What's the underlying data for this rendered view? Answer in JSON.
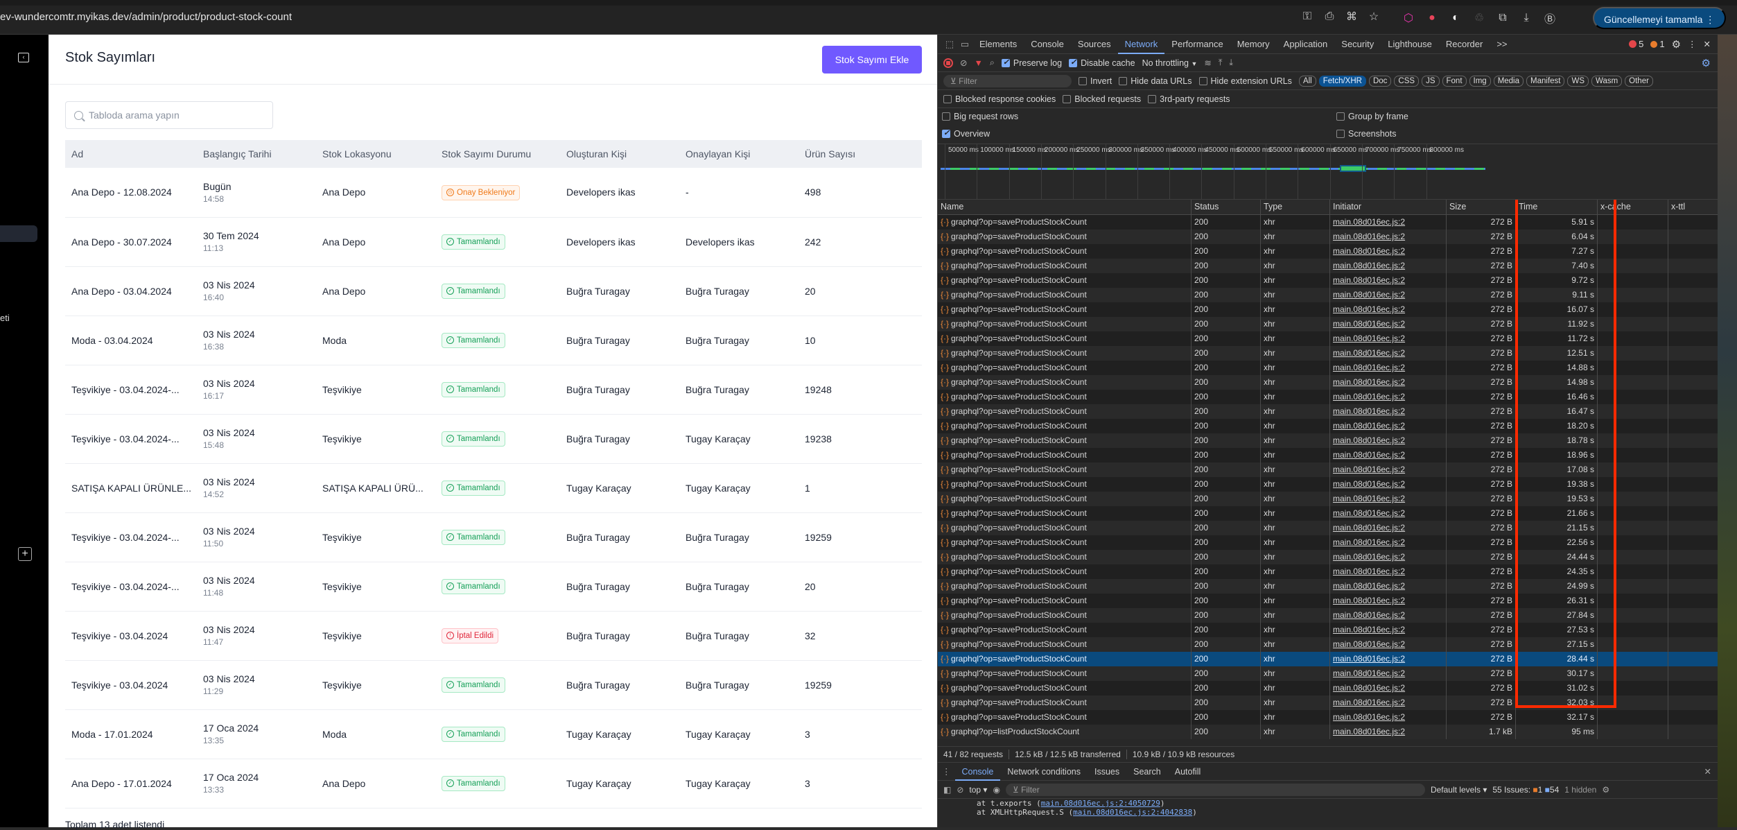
{
  "browser": {
    "url": "ev-wundercomtr.myikas.dev/admin/product/product-stock-count",
    "update_button": "Güncellemeyi tamamla",
    "omnibox_icons": [
      "key-icon",
      "install-icon",
      "translate-icon",
      "star-icon"
    ],
    "extension_icons": [
      "graphql-extension-icon",
      "strawberry-extension-icon",
      "color-extension-icon",
      "recycle-extension-icon",
      "puzzle-icon",
      "download-icon",
      "profile-avatar-icon"
    ]
  },
  "sidebar": {
    "partial_label": "eti"
  },
  "page": {
    "title": "Stok Sayımları",
    "add_button": "Stok Sayımı Ekle",
    "search_placeholder": "Tabloda arama yapın",
    "columns": [
      "Ad",
      "Başlangıç Tarihi",
      "Stok Lokasyonu",
      "Stok Sayımı Durumu",
      "Oluşturan Kişi",
      "Onaylayan Kişi",
      "Ürün Sayısı"
    ],
    "rows": [
      {
        "name": "Ana Depo - 12.08.2024",
        "date": "Bugün",
        "time": "14:58",
        "location": "Ana Depo",
        "status": "Onay Bekleniyor",
        "status_type": "pending",
        "creator": "Developers ikas",
        "approver": "-",
        "count": "498"
      },
      {
        "name": "Ana Depo - 30.07.2024",
        "date": "30 Tem 2024",
        "time": "11:13",
        "location": "Ana Depo",
        "status": "Tamamlandı",
        "status_type": "done",
        "creator": "Developers ikas",
        "approver": "Developers ikas",
        "count": "242"
      },
      {
        "name": "Ana Depo - 03.04.2024",
        "date": "03 Nis 2024",
        "time": "16:40",
        "location": "Ana Depo",
        "status": "Tamamlandı",
        "status_type": "done",
        "creator": "Buğra Turagay",
        "approver": "Buğra Turagay",
        "count": "20"
      },
      {
        "name": "Moda - 03.04.2024",
        "date": "03 Nis 2024",
        "time": "16:38",
        "location": "Moda",
        "status": "Tamamlandı",
        "status_type": "done",
        "creator": "Buğra Turagay",
        "approver": "Buğra Turagay",
        "count": "10"
      },
      {
        "name": "Teşvikiye - 03.04.2024-...",
        "date": "03 Nis 2024",
        "time": "16:17",
        "location": "Teşvikiye",
        "status": "Tamamlandı",
        "status_type": "done",
        "creator": "Buğra Turagay",
        "approver": "Buğra Turagay",
        "count": "19248"
      },
      {
        "name": "Teşvikiye - 03.04.2024-...",
        "date": "03 Nis 2024",
        "time": "15:48",
        "location": "Teşvikiye",
        "status": "Tamamlandı",
        "status_type": "done",
        "creator": "Buğra Turagay",
        "approver": "Tugay Karaçay",
        "count": "19238"
      },
      {
        "name": "SATIŞA KAPALI ÜRÜNLE...",
        "date": "03 Nis 2024",
        "time": "14:52",
        "location": "SATIŞA KAPALI ÜRÜ...",
        "status": "Tamamlandı",
        "status_type": "done",
        "creator": "Tugay Karaçay",
        "approver": "Tugay Karaçay",
        "count": "1"
      },
      {
        "name": "Teşvikiye - 03.04.2024-...",
        "date": "03 Nis 2024",
        "time": "11:50",
        "location": "Teşvikiye",
        "status": "Tamamlandı",
        "status_type": "done",
        "creator": "Buğra Turagay",
        "approver": "Buğra Turagay",
        "count": "19259"
      },
      {
        "name": "Teşvikiye - 03.04.2024-...",
        "date": "03 Nis 2024",
        "time": "11:48",
        "location": "Teşvikiye",
        "status": "Tamamlandı",
        "status_type": "done",
        "creator": "Buğra Turagay",
        "approver": "Buğra Turagay",
        "count": "20"
      },
      {
        "name": "Teşvikiye - 03.04.2024",
        "date": "03 Nis 2024",
        "time": "11:47",
        "location": "Teşvikiye",
        "status": "İptal Edildi",
        "status_type": "cancel",
        "creator": "Buğra Turagay",
        "approver": "Buğra Turagay",
        "count": "32"
      },
      {
        "name": "Teşvikiye - 03.04.2024",
        "date": "03 Nis 2024",
        "time": "11:29",
        "location": "Teşvikiye",
        "status": "Tamamlandı",
        "status_type": "done",
        "creator": "Buğra Turagay",
        "approver": "Buğra Turagay",
        "count": "19259"
      },
      {
        "name": "Moda - 17.01.2024",
        "date": "17 Oca 2024",
        "time": "13:35",
        "location": "Moda",
        "status": "Tamamlandı",
        "status_type": "done",
        "creator": "Tugay Karaçay",
        "approver": "Tugay Karaçay",
        "count": "3"
      },
      {
        "name": "Ana Depo - 17.01.2024",
        "date": "17 Oca 2024",
        "time": "13:33",
        "location": "Ana Depo",
        "status": "Tamamlandı",
        "status_type": "done",
        "creator": "Tugay Karaçay",
        "approver": "Tugay Karaçay",
        "count": "3"
      }
    ],
    "footer": "Toplam 13 adet listendi"
  },
  "devtools": {
    "tabs": [
      "Elements",
      "Console",
      "Sources",
      "Network",
      "Performance",
      "Memory",
      "Application",
      "Security",
      "Lighthouse",
      "Recorder"
    ],
    "active_tab": "Network",
    "more_tabs": ">>",
    "error_count": "5",
    "warning_count": "1",
    "toolbar": {
      "preserve_log": "Preserve log",
      "disable_cache": "Disable cache",
      "throttling": "No throttling"
    },
    "filter": {
      "placeholder": "Filter",
      "invert": "Invert",
      "hide_data_urls": "Hide data URLs",
      "hide_extension_urls": "Hide extension URLs",
      "types": [
        "All",
        "Fetch/XHR",
        "Doc",
        "CSS",
        "JS",
        "Font",
        "Img",
        "Media",
        "Manifest",
        "WS",
        "Wasm",
        "Other"
      ],
      "selected_type": "Fetch/XHR",
      "blocked_response_cookies": "Blocked response cookies",
      "blocked_requests": "Blocked requests",
      "third_party": "3rd-party requests"
    },
    "options": {
      "big_rows": "Big request rows",
      "group_by_frame": "Group by frame",
      "overview": "Overview",
      "screenshots": "Screenshots"
    },
    "overview_ticks": [
      "50000 ms",
      "100000 ms",
      "150000 ms",
      "200000 ms",
      "250000 ms",
      "300000 ms",
      "350000 ms",
      "400000 ms",
      "450000 ms",
      "500000 ms",
      "550000 ms",
      "600000 ms",
      "650000 ms",
      "700000 ms",
      "750000 ms",
      "800000 ms"
    ],
    "columns": [
      "Name",
      "Status",
      "Type",
      "Initiator",
      "Size",
      "Time",
      "x-cache",
      "x-ttl"
    ],
    "requests": [
      {
        "name": "graphql?op=saveProductStockCount",
        "status": "200",
        "type": "xhr",
        "initiator": "main.08d016ec.js:2",
        "size": "272 B",
        "time": "5.91 s"
      },
      {
        "name": "graphql?op=saveProductStockCount",
        "status": "200",
        "type": "xhr",
        "initiator": "main.08d016ec.js:2",
        "size": "272 B",
        "time": "6.04 s"
      },
      {
        "name": "graphql?op=saveProductStockCount",
        "status": "200",
        "type": "xhr",
        "initiator": "main.08d016ec.js:2",
        "size": "272 B",
        "time": "7.27 s"
      },
      {
        "name": "graphql?op=saveProductStockCount",
        "status": "200",
        "type": "xhr",
        "initiator": "main.08d016ec.js:2",
        "size": "272 B",
        "time": "7.40 s"
      },
      {
        "name": "graphql?op=saveProductStockCount",
        "status": "200",
        "type": "xhr",
        "initiator": "main.08d016ec.js:2",
        "size": "272 B",
        "time": "9.72 s"
      },
      {
        "name": "graphql?op=saveProductStockCount",
        "status": "200",
        "type": "xhr",
        "initiator": "main.08d016ec.js:2",
        "size": "272 B",
        "time": "9.11 s"
      },
      {
        "name": "graphql?op=saveProductStockCount",
        "status": "200",
        "type": "xhr",
        "initiator": "main.08d016ec.js:2",
        "size": "272 B",
        "time": "16.07 s"
      },
      {
        "name": "graphql?op=saveProductStockCount",
        "status": "200",
        "type": "xhr",
        "initiator": "main.08d016ec.js:2",
        "size": "272 B",
        "time": "11.92 s"
      },
      {
        "name": "graphql?op=saveProductStockCount",
        "status": "200",
        "type": "xhr",
        "initiator": "main.08d016ec.js:2",
        "size": "272 B",
        "time": "11.72 s"
      },
      {
        "name": "graphql?op=saveProductStockCount",
        "status": "200",
        "type": "xhr",
        "initiator": "main.08d016ec.js:2",
        "size": "272 B",
        "time": "12.51 s"
      },
      {
        "name": "graphql?op=saveProductStockCount",
        "status": "200",
        "type": "xhr",
        "initiator": "main.08d016ec.js:2",
        "size": "272 B",
        "time": "14.88 s"
      },
      {
        "name": "graphql?op=saveProductStockCount",
        "status": "200",
        "type": "xhr",
        "initiator": "main.08d016ec.js:2",
        "size": "272 B",
        "time": "14.98 s"
      },
      {
        "name": "graphql?op=saveProductStockCount",
        "status": "200",
        "type": "xhr",
        "initiator": "main.08d016ec.js:2",
        "size": "272 B",
        "time": "16.46 s"
      },
      {
        "name": "graphql?op=saveProductStockCount",
        "status": "200",
        "type": "xhr",
        "initiator": "main.08d016ec.js:2",
        "size": "272 B",
        "time": "16.47 s"
      },
      {
        "name": "graphql?op=saveProductStockCount",
        "status": "200",
        "type": "xhr",
        "initiator": "main.08d016ec.js:2",
        "size": "272 B",
        "time": "18.20 s"
      },
      {
        "name": "graphql?op=saveProductStockCount",
        "status": "200",
        "type": "xhr",
        "initiator": "main.08d016ec.js:2",
        "size": "272 B",
        "time": "18.78 s"
      },
      {
        "name": "graphql?op=saveProductStockCount",
        "status": "200",
        "type": "xhr",
        "initiator": "main.08d016ec.js:2",
        "size": "272 B",
        "time": "18.96 s"
      },
      {
        "name": "graphql?op=saveProductStockCount",
        "status": "200",
        "type": "xhr",
        "initiator": "main.08d016ec.js:2",
        "size": "272 B",
        "time": "17.08 s"
      },
      {
        "name": "graphql?op=saveProductStockCount",
        "status": "200",
        "type": "xhr",
        "initiator": "main.08d016ec.js:2",
        "size": "272 B",
        "time": "19.38 s"
      },
      {
        "name": "graphql?op=saveProductStockCount",
        "status": "200",
        "type": "xhr",
        "initiator": "main.08d016ec.js:2",
        "size": "272 B",
        "time": "19.53 s"
      },
      {
        "name": "graphql?op=saveProductStockCount",
        "status": "200",
        "type": "xhr",
        "initiator": "main.08d016ec.js:2",
        "size": "272 B",
        "time": "21.66 s"
      },
      {
        "name": "graphql?op=saveProductStockCount",
        "status": "200",
        "type": "xhr",
        "initiator": "main.08d016ec.js:2",
        "size": "272 B",
        "time": "21.15 s"
      },
      {
        "name": "graphql?op=saveProductStockCount",
        "status": "200",
        "type": "xhr",
        "initiator": "main.08d016ec.js:2",
        "size": "272 B",
        "time": "22.56 s"
      },
      {
        "name": "graphql?op=saveProductStockCount",
        "status": "200",
        "type": "xhr",
        "initiator": "main.08d016ec.js:2",
        "size": "272 B",
        "time": "24.44 s"
      },
      {
        "name": "graphql?op=saveProductStockCount",
        "status": "200",
        "type": "xhr",
        "initiator": "main.08d016ec.js:2",
        "size": "272 B",
        "time": "24.35 s"
      },
      {
        "name": "graphql?op=saveProductStockCount",
        "status": "200",
        "type": "xhr",
        "initiator": "main.08d016ec.js:2",
        "size": "272 B",
        "time": "24.99 s"
      },
      {
        "name": "graphql?op=saveProductStockCount",
        "status": "200",
        "type": "xhr",
        "initiator": "main.08d016ec.js:2",
        "size": "272 B",
        "time": "26.31 s"
      },
      {
        "name": "graphql?op=saveProductStockCount",
        "status": "200",
        "type": "xhr",
        "initiator": "main.08d016ec.js:2",
        "size": "272 B",
        "time": "27.84 s"
      },
      {
        "name": "graphql?op=saveProductStockCount",
        "status": "200",
        "type": "xhr",
        "initiator": "main.08d016ec.js:2",
        "size": "272 B",
        "time": "27.53 s"
      },
      {
        "name": "graphql?op=saveProductStockCount",
        "status": "200",
        "type": "xhr",
        "initiator": "main.08d016ec.js:2",
        "size": "272 B",
        "time": "27.15 s"
      },
      {
        "name": "graphql?op=saveProductStockCount",
        "status": "200",
        "type": "xhr",
        "initiator": "main.08d016ec.js:2",
        "size": "272 B",
        "time": "28.44 s",
        "selected": true
      },
      {
        "name": "graphql?op=saveProductStockCount",
        "status": "200",
        "type": "xhr",
        "initiator": "main.08d016ec.js:2",
        "size": "272 B",
        "time": "30.17 s"
      },
      {
        "name": "graphql?op=saveProductStockCount",
        "status": "200",
        "type": "xhr",
        "initiator": "main.08d016ec.js:2",
        "size": "272 B",
        "time": "31.02 s"
      },
      {
        "name": "graphql?op=saveProductStockCount",
        "status": "200",
        "type": "xhr",
        "initiator": "main.08d016ec.js:2",
        "size": "272 B",
        "time": "32.03 s"
      },
      {
        "name": "graphql?op=saveProductStockCount",
        "status": "200",
        "type": "xhr",
        "initiator": "main.08d016ec.js:2",
        "size": "272 B",
        "time": "32.17 s"
      },
      {
        "name": "graphql?op=listProductStockCount",
        "status": "200",
        "type": "xhr",
        "initiator": "main.08d016ec.js:2",
        "size": "1.7 kB",
        "time": "95 ms"
      }
    ],
    "summary": {
      "requests": "41 / 82 requests",
      "transferred": "12.5 kB / 12.5 kB transferred",
      "resources": "10.9 kB / 10.9 kB resources"
    },
    "drawer_tabs": [
      "Console",
      "Network conditions",
      "Issues",
      "Search",
      "Autofill"
    ],
    "drawer_active": "Console",
    "console": {
      "context": "top",
      "filter_placeholder": "Filter",
      "levels": "Default levels",
      "issues_label": "55 Issues:",
      "issues_warn": "1",
      "issues_info": "54",
      "hidden": "1 hidden",
      "log_lines": [
        {
          "prefix": "at t.exports (",
          "link": "main.08d016ec.js:2:4050729",
          "suffix": ")"
        },
        {
          "prefix": "at XMLHttpRequest.S (",
          "link": "main.08d016ec.js:2:4042838",
          "suffix": ")"
        }
      ]
    }
  }
}
